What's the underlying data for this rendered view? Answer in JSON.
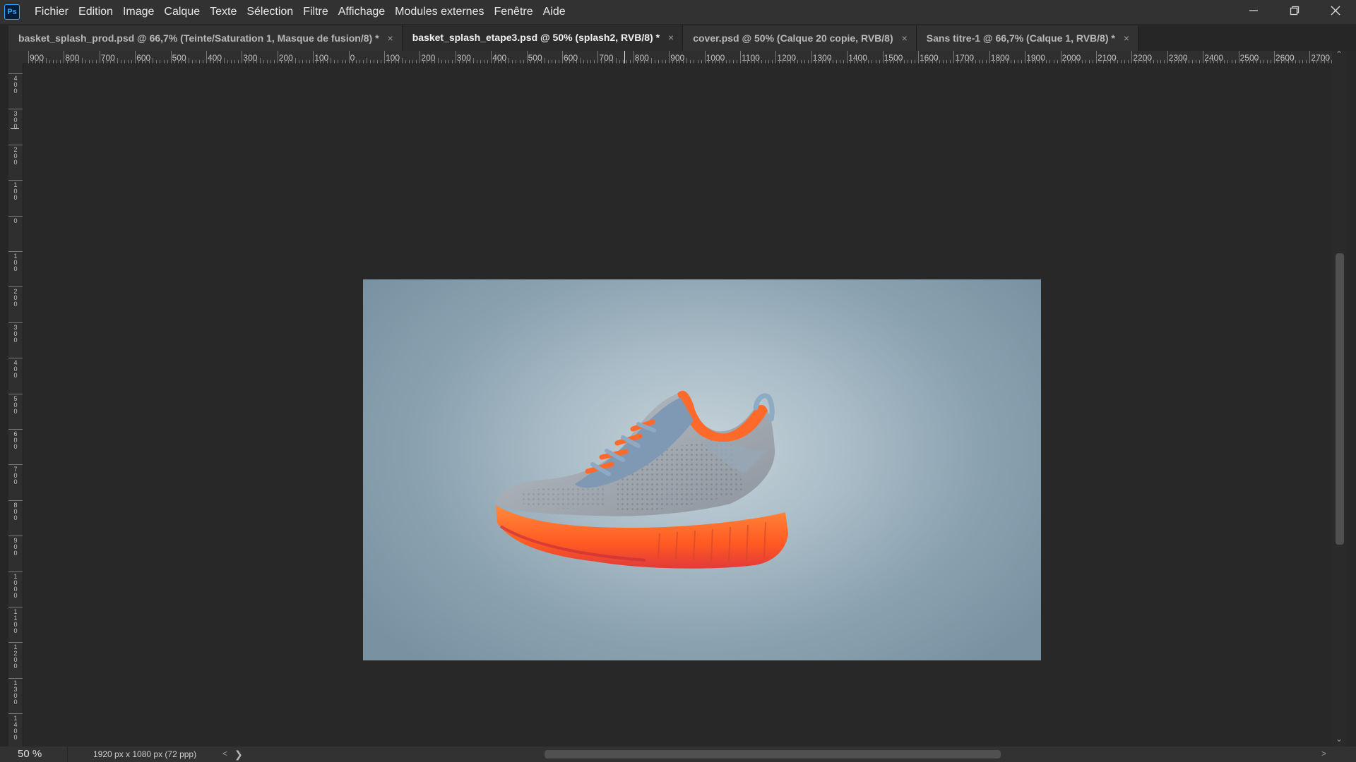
{
  "app": {
    "logo": "Ps",
    "accent": "#31a8ff"
  },
  "menu": [
    "Fichier",
    "Edition",
    "Image",
    "Calque",
    "Texte",
    "Sélection",
    "Filtre",
    "Affichage",
    "Modules externes",
    "Fenêtre",
    "Aide"
  ],
  "tabs": [
    {
      "label": "basket_splash_prod.psd @ 66,7% (Teinte/Saturation 1, Masque de fusion/8) *",
      "active": false
    },
    {
      "label": "basket_splash_etape3.psd @ 50% (splash2, RVB/8) *",
      "active": true
    },
    {
      "label": "cover.psd @ 50% (Calque 20 copie, RVB/8)",
      "active": false
    },
    {
      "label": "Sans titre-1 @ 66,7% (Calque 1, RVB/8) *",
      "active": false
    }
  ],
  "ruler_h_labels": [
    "900",
    "800",
    "700",
    "600",
    "500",
    "400",
    "300",
    "200",
    "100",
    "0",
    "100",
    "200",
    "300",
    "400",
    "500",
    "600",
    "700",
    "800",
    "900",
    "1000",
    "1100",
    "1200",
    "1300",
    "1400",
    "1500",
    "1600",
    "1700",
    "1800",
    "1900",
    "2000",
    "2100",
    "2200",
    "2300",
    "2400",
    "2500",
    "2600",
    "2700"
  ],
  "ruler_v_labels": [
    "400",
    "300",
    "200",
    "100",
    "0",
    "100",
    "200",
    "300",
    "400",
    "500",
    "600",
    "700",
    "800",
    "900",
    "1000",
    "1100",
    "1200",
    "1300",
    "1400"
  ],
  "status": {
    "zoom": "50 %",
    "doc_info": "1920 px x 1080 px (72 ppp)"
  },
  "icons": {
    "minimize": "minimize-icon",
    "restore": "restore-icon",
    "close": "close-icon",
    "tab_close": "×"
  },
  "colors": {
    "sole": "#ff6a2b",
    "background": "#8ca3b1"
  }
}
